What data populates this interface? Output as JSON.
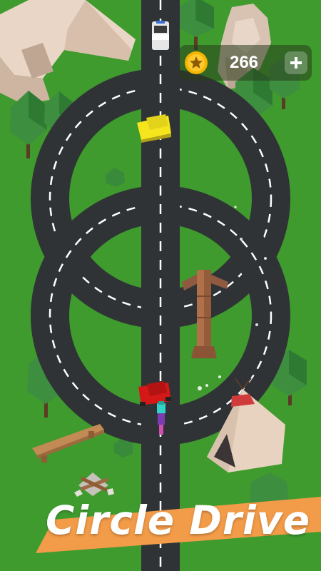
{
  "game": {
    "title": "Circle Drive",
    "coins": "266",
    "add_button_label": "+",
    "icons": {
      "coin": "star-coin-icon",
      "add": "plus-icon"
    }
  },
  "colors": {
    "grass": "#3f9b2e",
    "road": "#2f3336",
    "lane_mark": "#ffffff",
    "tree": "#3e8e40",
    "coin": "#f4b400",
    "banner": "#f29b48",
    "player_car": "#d41818",
    "npc_car": "#f4e51d"
  }
}
